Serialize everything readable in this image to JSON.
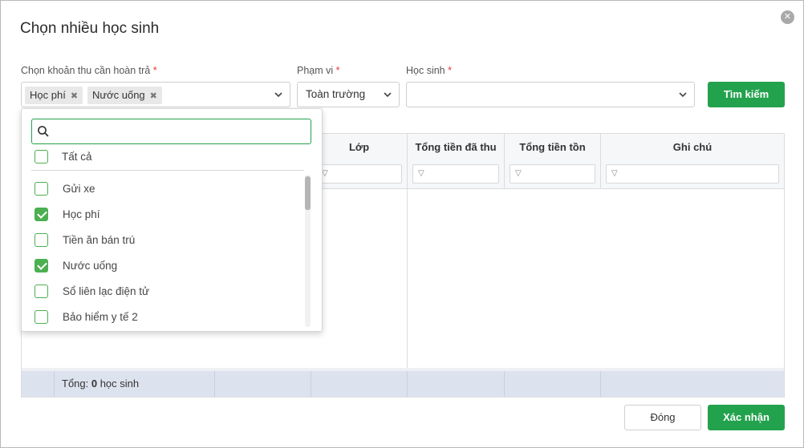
{
  "dialog": {
    "title": "Chọn nhiều học sinh",
    "close_icon": "close-circle-icon"
  },
  "filters": {
    "khoan_thu": {
      "label": "Chọn khoản thu cần hoàn trả",
      "required_mark": "*",
      "tags": [
        "Học phí",
        "Nước uống"
      ],
      "tag_remove_glyph": "✖"
    },
    "pham_vi": {
      "label": "Phạm vi",
      "required_mark": "*",
      "value": "Toàn trường"
    },
    "hoc_sinh": {
      "label": "Học sinh",
      "required_mark": "*",
      "value": ""
    },
    "search_button": "Tìm kiếm"
  },
  "dropdown": {
    "search_placeholder": "",
    "select_all": {
      "label": "Tất cả",
      "checked": false
    },
    "options": [
      {
        "label": "Gửi xe",
        "checked": false
      },
      {
        "label": "Học phí",
        "checked": true
      },
      {
        "label": "Tiền ăn bán trú",
        "checked": false
      },
      {
        "label": "Nước uống",
        "checked": true
      },
      {
        "label": "Sổ liên lạc điện tử",
        "checked": false
      },
      {
        "label": "Bảo hiểm y tế 2",
        "checked": false
      }
    ]
  },
  "grid": {
    "columns": [
      "Lớp",
      "Tổng tiền đã thu",
      "Tổng tiền tồn",
      "Ghi chú"
    ],
    "filter_icon": "funnel-icon",
    "footer": {
      "total_prefix": "Tổng: ",
      "total_count": "0",
      "total_suffix": " học sinh"
    }
  },
  "actions": {
    "close": "Đóng",
    "confirm": "Xác nhận"
  },
  "colors": {
    "primary_green": "#23a24d",
    "checkbox_green": "#4caf50",
    "required_red": "#e53935",
    "footer_bg": "#dde3ee"
  }
}
